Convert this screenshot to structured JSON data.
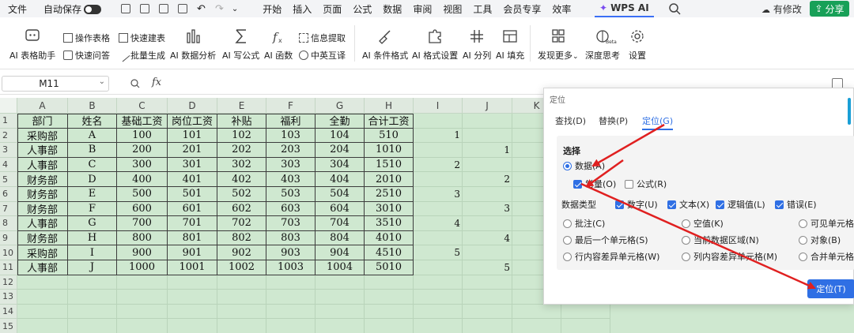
{
  "menubar": {
    "file": "文件",
    "autosave": "自动保存",
    "menus": [
      "开始",
      "插入",
      "页面",
      "公式",
      "数据",
      "审阅",
      "视图",
      "工具",
      "会员专享",
      "效率"
    ],
    "ai_tab": "WPS AI",
    "modified": "有修改",
    "share": "分享"
  },
  "ribbon": {
    "ai_table_assistant": "AI 表格助手",
    "operate_table": "操作表格",
    "quick_qa": "快速问答",
    "quick_build_table": "快速建表",
    "batch_generate": "批量生成",
    "ai_data_analysis": "AI 数据分析",
    "ai_write_formula": "AI 写公式",
    "ai_function": "AI 函数",
    "info_extract": "信息提取",
    "cn_en_translate": "中英互译",
    "ai_conditional_format": "AI 条件格式",
    "ai_format_settings": "AI 格式设置",
    "ai_split_column": "AI 分列",
    "ai_fill": "AI 填充",
    "discover_more": "发现更多",
    "deep_thinking": "深度思考",
    "beta": "Beta",
    "settings": "设置"
  },
  "formula_bar": {
    "cell_ref": "M11",
    "fx": "fx",
    "formula": ""
  },
  "sheet": {
    "columns": [
      "A",
      "B",
      "C",
      "D",
      "E",
      "F",
      "G",
      "H",
      "I",
      "J",
      "K"
    ],
    "rows": [
      "1",
      "2",
      "3",
      "4",
      "5",
      "6",
      "7",
      "8",
      "9",
      "10",
      "11",
      "12",
      "13",
      "14",
      "15"
    ],
    "header": [
      "部门",
      "姓名",
      "基础工资",
      "岗位工资",
      "补贴",
      "福利",
      "全勤",
      "合计工资"
    ],
    "data": [
      [
        "采购部",
        "A",
        "100",
        "101",
        "102",
        "103",
        "104",
        "510"
      ],
      [
        "人事部",
        "B",
        "200",
        "201",
        "202",
        "203",
        "204",
        "1010"
      ],
      [
        "人事部",
        "C",
        "300",
        "301",
        "302",
        "303",
        "304",
        "1510"
      ],
      [
        "财务部",
        "D",
        "400",
        "401",
        "402",
        "403",
        "404",
        "2010"
      ],
      [
        "财务部",
        "E",
        "500",
        "501",
        "502",
        "503",
        "504",
        "2510"
      ],
      [
        "财务部",
        "F",
        "600",
        "601",
        "602",
        "603",
        "604",
        "3010"
      ],
      [
        "人事部",
        "G",
        "700",
        "701",
        "702",
        "703",
        "704",
        "3510"
      ],
      [
        "财务部",
        "H",
        "800",
        "801",
        "802",
        "803",
        "804",
        "4010"
      ],
      [
        "采购部",
        "I",
        "900",
        "901",
        "902",
        "903",
        "904",
        "4510"
      ],
      [
        "人事部",
        "J",
        "1000",
        "1001",
        "1002",
        "1003",
        "1004",
        "5010"
      ]
    ],
    "col_i": [
      "",
      "1",
      "",
      "2",
      "",
      "3",
      "",
      "4",
      "",
      "5",
      ""
    ],
    "col_j": [
      "",
      "",
      "1",
      "",
      "2",
      "",
      "3",
      "",
      "4",
      "",
      "5"
    ]
  },
  "dialog": {
    "title": "定位",
    "tabs": [
      "查找(D)",
      "替换(P)",
      "定位(G)"
    ],
    "select_label": "选择",
    "data_option": "数据(A)",
    "formula_option": "公式(R)",
    "constant_option": "常量(O)",
    "data_type_label": "数据类型",
    "number": "数字(U)",
    "text": "文本(X)",
    "logical": "逻辑值(L)",
    "error": "错误(E)",
    "comments": "批注(C)",
    "blank": "空值(K)",
    "visible_cells": "可见单元格",
    "last_cell": "最后一个单元格(S)",
    "current_region": "当前数据区域(N)",
    "objects": "对象(B)",
    "row_diff": "行内容差异单元格(W)",
    "col_diff": "列内容差异单元格(M)",
    "merged_cells": "合并单元格",
    "locate_button": "定位(T)"
  },
  "colors": {
    "sheet_fill": "#cfe8d0",
    "accent": "#2f6fe4",
    "share": "#18a058",
    "arrow": "#e02020"
  }
}
